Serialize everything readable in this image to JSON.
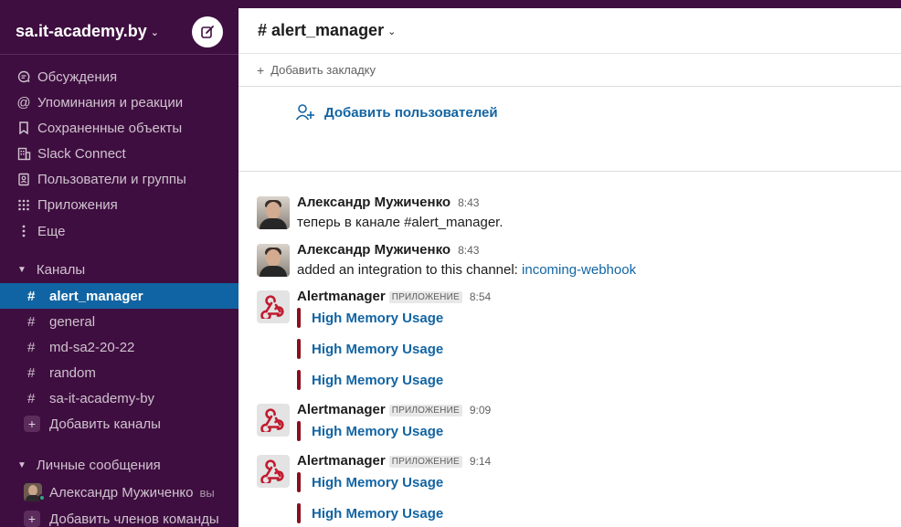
{
  "workspace": {
    "name": "sa.it-academy.by"
  },
  "sidebar": {
    "nav": [
      {
        "label": "Обсуждения",
        "icon": "threads-icon"
      },
      {
        "label": "Упоминания и реакции",
        "icon": "at-icon"
      },
      {
        "label": "Сохраненные объекты",
        "icon": "bookmark-icon"
      },
      {
        "label": "Slack Connect",
        "icon": "building-icon"
      },
      {
        "label": "Пользователи и группы",
        "icon": "contacts-icon"
      },
      {
        "label": "Приложения",
        "icon": "apps-grid-icon"
      },
      {
        "label": "Еще",
        "icon": "more-vertical-icon"
      }
    ],
    "channels_header": "Каналы",
    "channels": [
      "alert_manager",
      "general",
      "md-sa2-20-22",
      "random",
      "sa-it-academy-by"
    ],
    "active_channel": "alert_manager",
    "add_channels": "Добавить каналы",
    "dms_header": "Личные сообщения",
    "dms": [
      {
        "name": "Александр Мужиченко",
        "suffix": "вы"
      }
    ],
    "add_members": "Добавить членов команды"
  },
  "channel": {
    "title": "# alert_manager",
    "add_bookmark": "Добавить закладку",
    "add_users": "Добавить пользователей"
  },
  "messages": [
    {
      "author": "Александр Мужиченко",
      "time": "8:43",
      "text": "теперь в канале #alert_manager."
    },
    {
      "author": "Александр Мужиченко",
      "time": "8:43",
      "text_prefix": "added an integration to this channel: ",
      "link": "incoming-webhook"
    },
    {
      "author": "Alertmanager",
      "badge": "ПРИЛОЖЕНИЕ",
      "time": "8:54",
      "attachments": [
        "High Memory Usage",
        "High Memory Usage",
        "High Memory Usage"
      ]
    },
    {
      "author": "Alertmanager",
      "badge": "ПРИЛОЖЕНИЕ",
      "time": "9:09",
      "attachments": [
        "High Memory Usage"
      ]
    },
    {
      "author": "Alertmanager",
      "badge": "ПРИЛОЖЕНИЕ",
      "time": "9:14",
      "attachments": [
        "High Memory Usage",
        "High Memory Usage"
      ]
    }
  ],
  "colors": {
    "sidebar_bg": "#3f0e40",
    "active_item": "#1164a3",
    "link": "#1264a3",
    "attachment_bar": "#8b0e1a"
  }
}
